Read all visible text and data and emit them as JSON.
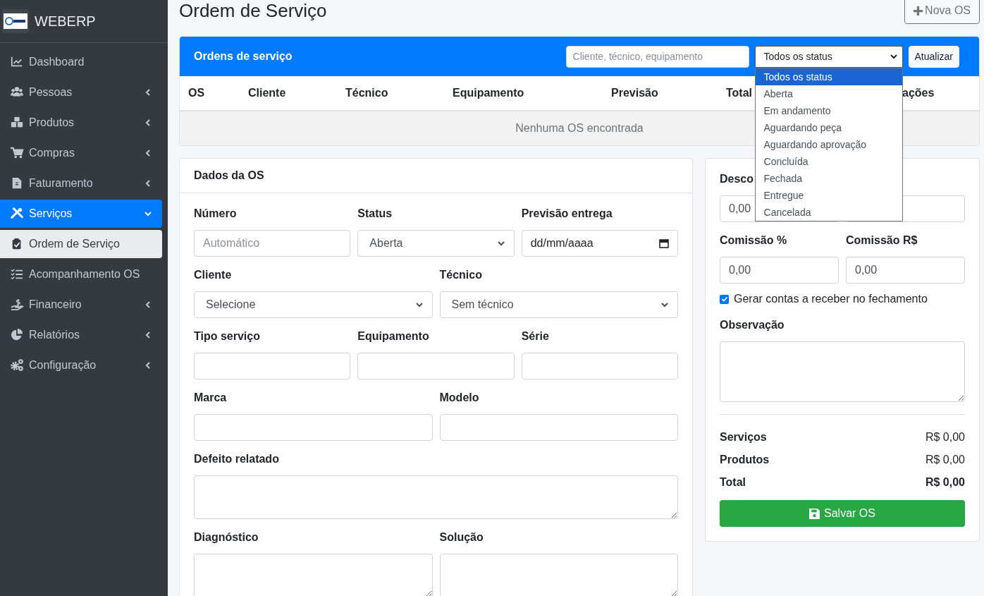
{
  "sidebar": {
    "brand": "WEBERP",
    "items": [
      {
        "label": "Dashboard",
        "selected": false
      },
      {
        "label": "Pessoas",
        "selected": false,
        "expanded": false
      },
      {
        "label": "Produtos",
        "selected": false,
        "expanded": false
      },
      {
        "label": "Compras",
        "selected": false,
        "expanded": false
      },
      {
        "label": "Faturamento",
        "selected": false,
        "expanded": false
      },
      {
        "label": "Serviços",
        "selected": true,
        "expanded": true,
        "children": [
          {
            "label": "Ordem de Serviço",
            "selected": true
          },
          {
            "label": "Acompanhamento OS",
            "selected": false
          }
        ]
      },
      {
        "label": "Financeiro",
        "selected": false,
        "expanded": false
      },
      {
        "label": "Relatórios",
        "selected": false,
        "expanded": false
      },
      {
        "label": "Configuração",
        "selected": false,
        "expanded": false
      }
    ]
  },
  "page": {
    "title": "Ordem de Serviço",
    "new_button": "Nova OS"
  },
  "orders": {
    "title": "Ordens de serviço",
    "search": {
      "placeholder": "Cliente, técnico, equipamento"
    },
    "status_filter": {
      "value": "Todos os status",
      "expanded": true,
      "options": [
        {
          "label": "Todos os status",
          "selected": true
        },
        {
          "label": "Aberta",
          "selected": false
        },
        {
          "label": "Em andamento",
          "selected": false
        },
        {
          "label": "Aguardando peça",
          "selected": false
        },
        {
          "label": "Aguardando aprovação",
          "selected": false
        },
        {
          "label": "Concluída",
          "selected": false
        },
        {
          "label": "Fechada",
          "selected": false
        },
        {
          "label": "Entregue",
          "selected": false
        },
        {
          "label": "Cancelada",
          "selected": false
        }
      ]
    },
    "refresh_button": "Atualizar",
    "table": {
      "columns": [
        "OS",
        "Cliente",
        "Técnico",
        "Equipamento",
        "Previsão",
        "Total",
        "ações"
      ],
      "empty_message": "Nenhuma OS encontrada"
    }
  },
  "os_form": {
    "title": "Dados da OS",
    "rows": [
      [
        {
          "label": "Número",
          "kind": "input",
          "placeholder": "Automático"
        },
        {
          "label": "Status",
          "kind": "select",
          "value": "Aberta"
        },
        {
          "label": "Previsão entrega",
          "kind": "date",
          "value": "dd/mm/aaaa"
        }
      ],
      [
        {
          "label": "Cliente",
          "kind": "select",
          "value": "Selecione"
        },
        {
          "label": "Técnico",
          "kind": "select",
          "value": "Sem técnico"
        }
      ],
      [
        {
          "label": "Tipo serviço",
          "kind": "input"
        },
        {
          "label": "Equipamento",
          "kind": "input"
        },
        {
          "label": "Série",
          "kind": "input"
        }
      ],
      [
        {
          "label": "Marca",
          "kind": "input"
        },
        {
          "label": "Modelo",
          "kind": "input"
        }
      ],
      [
        {
          "label": "Defeito relatado",
          "kind": "textarea"
        }
      ],
      [
        {
          "label": "Diagnóstico",
          "kind": "textarea"
        },
        {
          "label": "Solução",
          "kind": "textarea"
        }
      ]
    ]
  },
  "summary": {
    "rows": [
      [
        {
          "label": "Desco",
          "kind": "input",
          "value": "0,00"
        },
        {
          "kind": "input"
        }
      ],
      [
        {
          "label": "Comissão %",
          "kind": "input",
          "value": "0,00"
        },
        {
          "label": "Comissão R$",
          "kind": "input",
          "value": "0,00"
        }
      ]
    ],
    "receivable_checkbox": {
      "label": "Gerar contas a receber no fechamento",
      "checked": true
    },
    "note": {
      "label": "Observação"
    },
    "totals": [
      {
        "label": "Serviços",
        "value": "R$ 0,00",
        "kind": "line"
      },
      {
        "label": "Produtos",
        "value": "R$ 0,00",
        "kind": "line"
      },
      {
        "label": "Total",
        "value": "R$ 0,00",
        "kind": "total"
      }
    ],
    "save_button": "Salvar OS"
  }
}
